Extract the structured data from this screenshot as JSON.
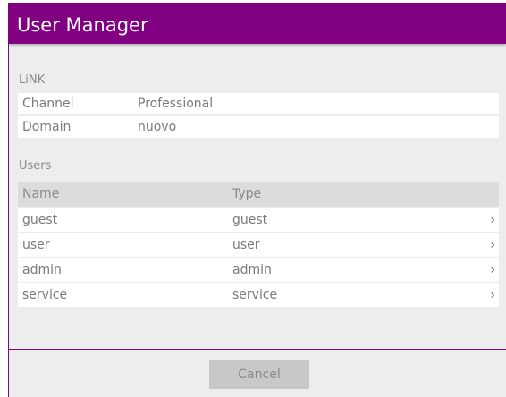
{
  "dialog": {
    "title": "User Manager"
  },
  "link": {
    "section_label": "LiNK",
    "rows": [
      {
        "key": "Channel",
        "value": "Professional"
      },
      {
        "key": "Domain",
        "value": "nuovo"
      }
    ]
  },
  "users": {
    "section_label": "Users",
    "columns": [
      "Name",
      "Type"
    ],
    "rows": [
      {
        "name": "guest",
        "type": "guest"
      },
      {
        "name": "user",
        "type": "user"
      },
      {
        "name": "admin",
        "type": "admin"
      },
      {
        "name": "service",
        "type": "service"
      }
    ],
    "row_chevron": "›"
  },
  "footer": {
    "cancel_label": "Cancel"
  },
  "colors": {
    "title_bar": "#820082",
    "dialog_bg": "#ededed"
  }
}
